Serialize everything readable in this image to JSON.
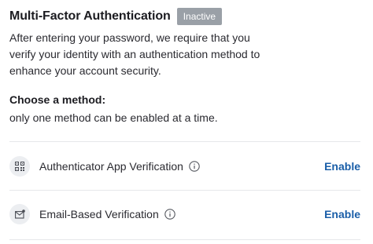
{
  "header": {
    "title": "Multi-Factor Authentication",
    "status_badge": "Inactive"
  },
  "description": "After entering your password, we require that you verify your identity with an authentication method to enhance your account security.",
  "method_section": {
    "heading": "Choose a method:",
    "subtext": "only one method can be enabled at a time."
  },
  "methods": [
    {
      "label": "Authenticator App Verification",
      "icon": "qr-code-icon",
      "action": "Enable"
    },
    {
      "label": "Email-Based Verification",
      "icon": "envelope-icon",
      "action": "Enable"
    }
  ],
  "colors": {
    "badge_bg": "#9aa0a7",
    "link": "#1a5ea8",
    "icon_bg": "#eceef1"
  }
}
